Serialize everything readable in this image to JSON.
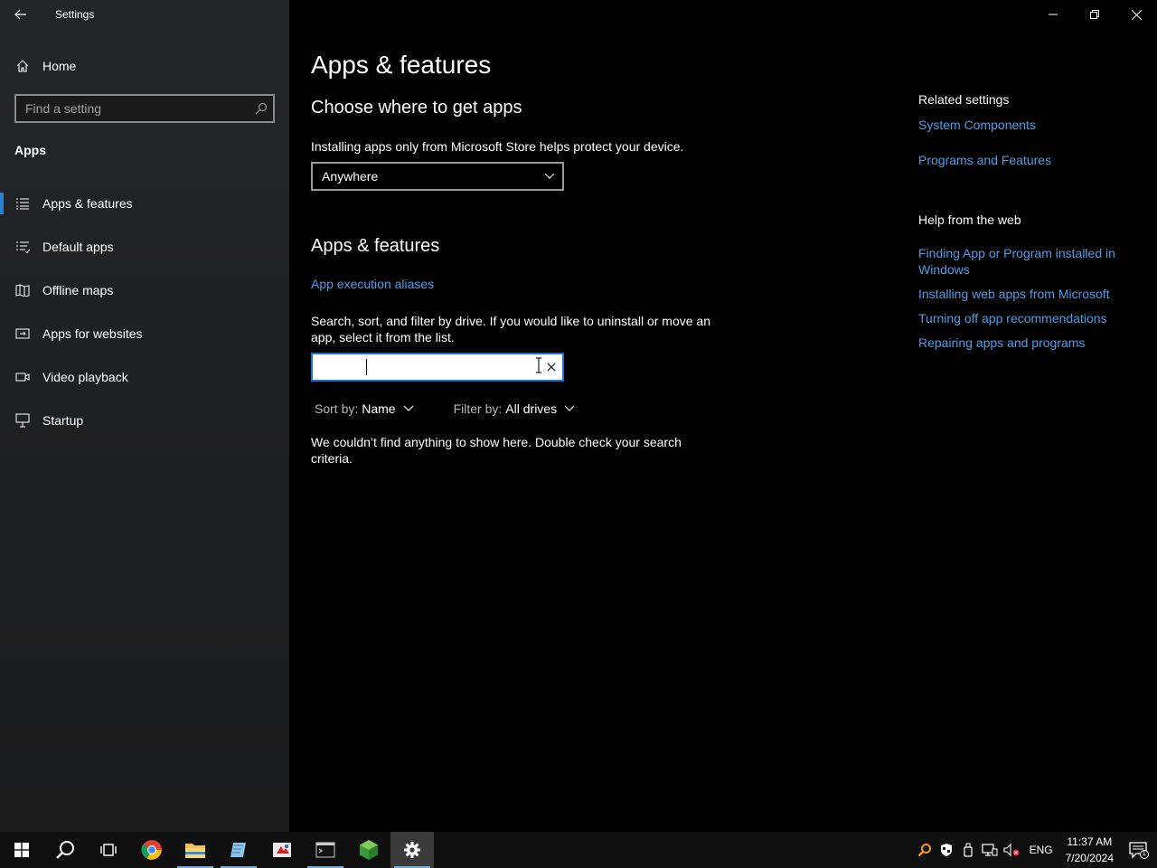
{
  "window": {
    "title": "Settings",
    "controls": [
      "minimize",
      "restore",
      "close"
    ]
  },
  "sidebar": {
    "home_label": "Home",
    "search_placeholder": "Find a setting",
    "section_heading": "Apps",
    "items": [
      {
        "label": "Apps & features",
        "icon": "apps-list-icon",
        "active": true
      },
      {
        "label": "Default apps",
        "icon": "default-apps-icon",
        "active": false
      },
      {
        "label": "Offline maps",
        "icon": "map-icon",
        "active": false
      },
      {
        "label": "Apps for websites",
        "icon": "open-in-app-icon",
        "active": false
      },
      {
        "label": "Video playback",
        "icon": "video-icon",
        "active": false
      },
      {
        "label": "Startup",
        "icon": "startup-icon",
        "active": false
      }
    ]
  },
  "main": {
    "page_title": "Apps & features",
    "choose_heading": "Choose where to get apps",
    "choose_desc": "Installing apps only from Microsoft Store helps protect your device.",
    "source_dropdown_value": "Anywhere",
    "features_heading": "Apps & features",
    "aliases_link": "App execution aliases",
    "search_desc": "Search, sort, and filter by drive. If you would like to uninstall or move an app, select it from the list.",
    "search_value": "",
    "sort_label": "Sort by:",
    "sort_value": "Name",
    "filter_label": "Filter by:",
    "filter_value": "All drives",
    "empty_message": "We couldn’t find anything to show here. Double check your search criteria."
  },
  "right": {
    "related_heading": "Related settings",
    "related_links": [
      "System Components",
      "Programs and Features"
    ],
    "help_heading": "Help from the web",
    "help_links": [
      "Finding App or Program installed in Windows",
      "Installing web apps from Microsoft",
      "Turning off app recommendations",
      "Repairing apps and programs"
    ]
  },
  "taskbar": {
    "apps": [
      "start",
      "search",
      "task-view",
      "chrome",
      "file-explorer",
      "notepad",
      "paint",
      "terminal",
      "green-app",
      "settings"
    ],
    "language": "ENG",
    "time": "11:37 AM",
    "date": "7/20/2024",
    "notification_count": "1"
  },
  "colors": {
    "accent": "#2f7fd1",
    "link": "#4d9ee6",
    "background": "#000000",
    "sidebar": "#1f2224"
  }
}
